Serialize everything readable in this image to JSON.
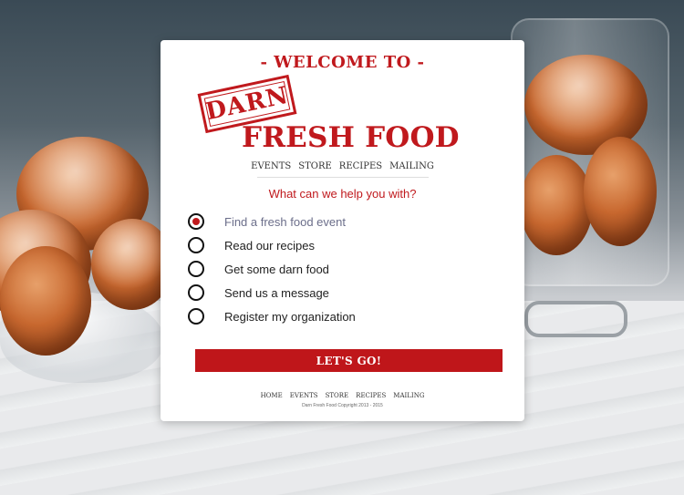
{
  "header": {
    "welcome": "- WELCOME TO -",
    "stamp": "DARN",
    "brand": "FRESH FOOD",
    "nav": [
      "EVENTS",
      "STORE",
      "RECIPES",
      "MAILING"
    ]
  },
  "form": {
    "question": "What can we help you with?",
    "options": [
      {
        "label": "Find a fresh food event",
        "selected": true
      },
      {
        "label": "Read our recipes",
        "selected": false
      },
      {
        "label": "Get some darn food",
        "selected": false
      },
      {
        "label": "Send us a message",
        "selected": false
      },
      {
        "label": "Register my organization",
        "selected": false
      }
    ],
    "submit_label": "LET'S GO!"
  },
  "footer": {
    "nav": [
      "HOME",
      "EVENTS",
      "STORE",
      "RECIPES",
      "MAILING"
    ],
    "copyright": "Darn Fresh Food Copyright 2013 - 2015"
  },
  "colors": {
    "accent": "#c0191d"
  }
}
